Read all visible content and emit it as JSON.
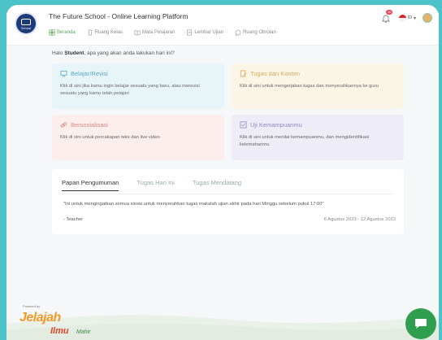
{
  "header": {
    "logo_text": "School",
    "title": "The Future School - Online Learning Platform",
    "notification_count": "10",
    "language": "ID",
    "nav": [
      {
        "label": "Beranda",
        "icon": "home-icon"
      },
      {
        "label": "Ruang Kelas",
        "icon": "classroom-icon"
      },
      {
        "label": "Mata Pelajaran",
        "icon": "book-icon"
      },
      {
        "label": "Lembar Ujian",
        "icon": "exam-icon"
      },
      {
        "label": "Ruang Obrolan",
        "icon": "chat-icon"
      }
    ]
  },
  "greeting": {
    "prefix": "Halo ",
    "name": "Student",
    "suffix": ", apa yang akan anda lakukan hari ini?"
  },
  "cards": [
    {
      "title": "Belajar/Revisi",
      "desc": "Klik di sini jika kamu ingin belajar sesuatu yang baru, atau merevisi sesuatu yang kamu telah pelajari",
      "color": "#5ba9c4"
    },
    {
      "title": "Tugas dan Konten",
      "desc": "Klik di sini untuk mengerjakan tugas dan menyerahkannya ke guru",
      "color": "#d5aa5a"
    },
    {
      "title": "Bersosialisasi",
      "desc": "Klik di sini untuk percakapan teks dan live video",
      "color": "#d98a83"
    },
    {
      "title": "Uji Kemampuanmu",
      "desc": "Klik di sini untuk menilai kemampuanmu, dan mengidentifikasi kelemahanmu",
      "color": "#8e86c4"
    }
  ],
  "board": {
    "tabs": [
      "Papan Pengumuman",
      "Tugas Hari Ini",
      "Tugas Mendatang"
    ],
    "announcement": "\"Ini untuk mengingatkan semua siswa untuk menyerahkan tugas makalah ujian akhir pada hari Minggu sebelum pukul 17:00\"",
    "author": "- Teacher",
    "date_range": "6 Agustus 2023 - 12 Agustus 2023"
  },
  "footer": {
    "powered_by": "Powered by",
    "brand": "Jelajah",
    "brand_sub": "Ilmu",
    "brand_sub2": "Mahir"
  }
}
